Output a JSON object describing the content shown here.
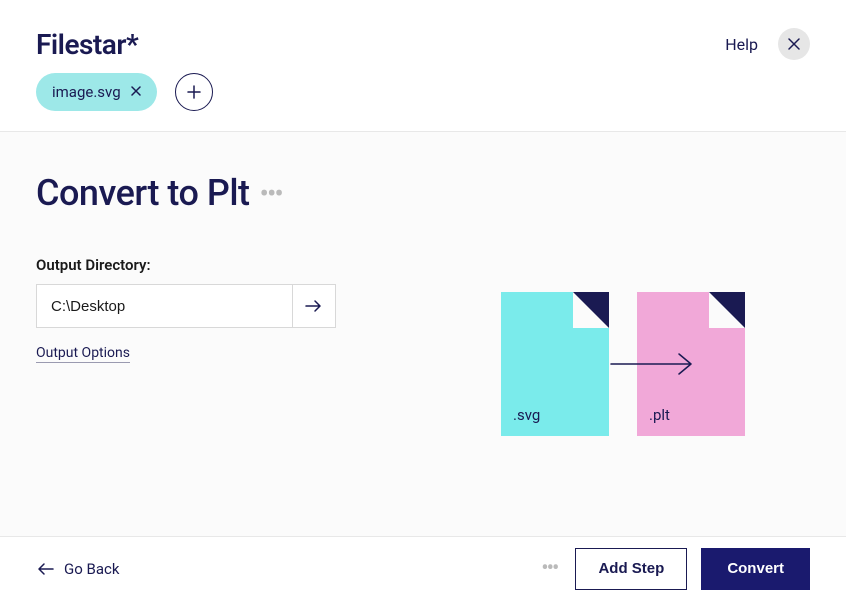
{
  "app": {
    "name": "Filestar",
    "star": "*"
  },
  "header": {
    "help_label": "Help"
  },
  "chips": {
    "items": [
      {
        "label": "image.svg"
      }
    ]
  },
  "page": {
    "title": "Convert to Plt"
  },
  "form": {
    "output_dir_label": "Output Directory:",
    "output_dir_value": "C:\\Desktop",
    "output_options_label": "Output Options"
  },
  "diagram": {
    "source_ext": ".svg",
    "target_ext": ".plt"
  },
  "footer": {
    "go_back_label": "Go Back",
    "add_step_label": "Add Step",
    "convert_label": "Convert"
  }
}
